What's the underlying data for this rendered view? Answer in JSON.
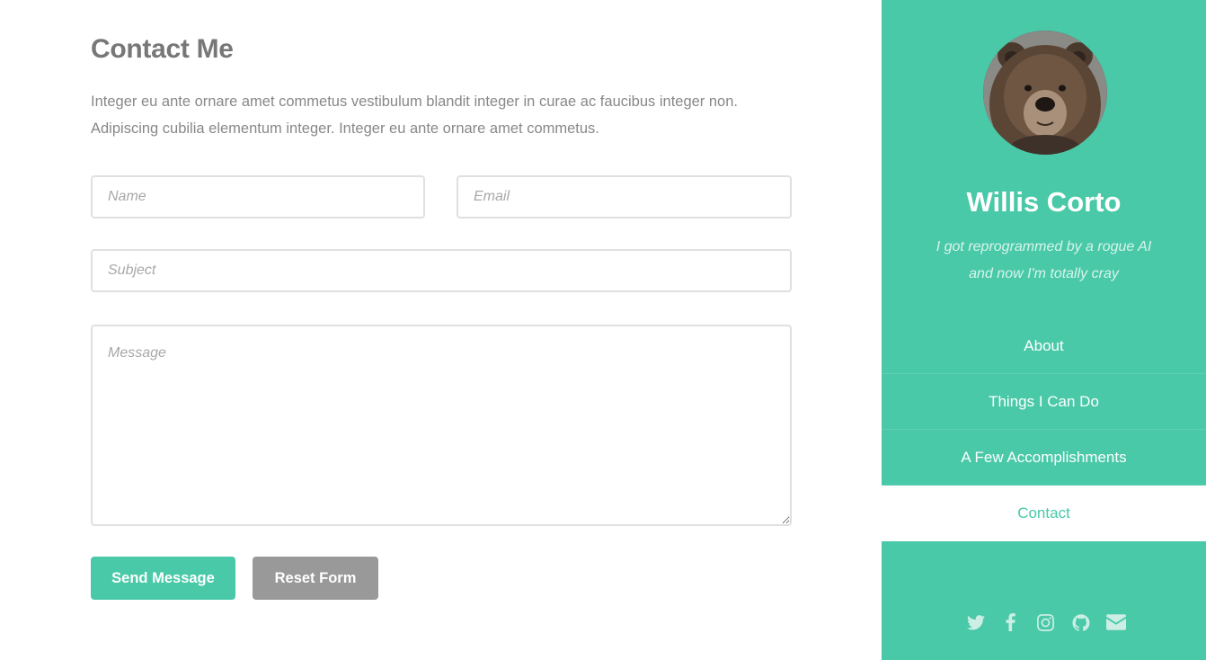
{
  "main": {
    "title": "Contact Me",
    "intro": "Integer eu ante ornare amet commetus vestibulum blandit integer in curae ac faucibus integer non. Adipiscing cubilia elementum integer. Integer eu ante ornare amet commetus.",
    "form": {
      "name_placeholder": "Name",
      "email_placeholder": "Email",
      "subject_placeholder": "Subject",
      "message_placeholder": "Message",
      "send_label": "Send Message",
      "reset_label": "Reset Form"
    }
  },
  "sidebar": {
    "name": "Willis Corto",
    "tagline_line1": "I got reprogrammed by a rogue AI",
    "tagline_line2": "and now I'm totally cray",
    "nav": [
      {
        "label": "About",
        "active": false
      },
      {
        "label": "Things I Can Do",
        "active": false
      },
      {
        "label": "A Few Accomplishments",
        "active": false
      },
      {
        "label": "Contact",
        "active": true
      }
    ],
    "social_icons": [
      "twitter-icon",
      "facebook-icon",
      "instagram-icon",
      "github-icon",
      "envelope-icon"
    ]
  },
  "colors": {
    "accent": "#49c9a8",
    "reset_button": "#999999",
    "heading": "#777777",
    "body_text": "#888888"
  }
}
